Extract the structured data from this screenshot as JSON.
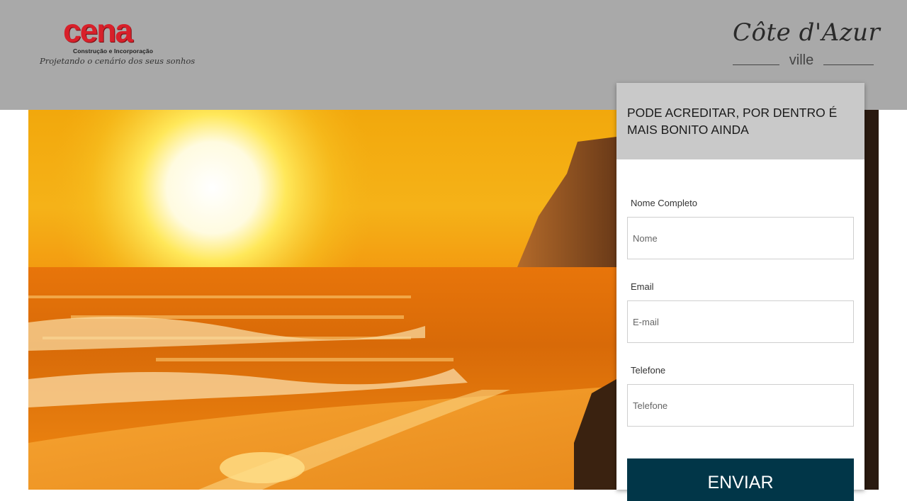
{
  "header": {
    "brand_left": {
      "name": "cena",
      "subtitle": "Construção e Incorporação",
      "tagline": "Projetando o cenário dos seus sonhos"
    },
    "brand_right": {
      "name": "Côte d'Azur",
      "sub": "ville"
    }
  },
  "form": {
    "title": "PODE ACREDITAR, POR DENTRO É MAIS BONITO AINDA",
    "fields": [
      {
        "label": "Nome Completo",
        "placeholder": "Nome"
      },
      {
        "label": "Email",
        "placeholder": "E-mail"
      },
      {
        "label": "Telefone",
        "placeholder": "Telefone"
      }
    ],
    "submit_label": "ENVIAR"
  },
  "colors": {
    "header_bg": "#a9a9a9",
    "form_header_bg": "#c9c9c9",
    "submit_bg": "#013648",
    "brand_red": "#d8202a"
  }
}
